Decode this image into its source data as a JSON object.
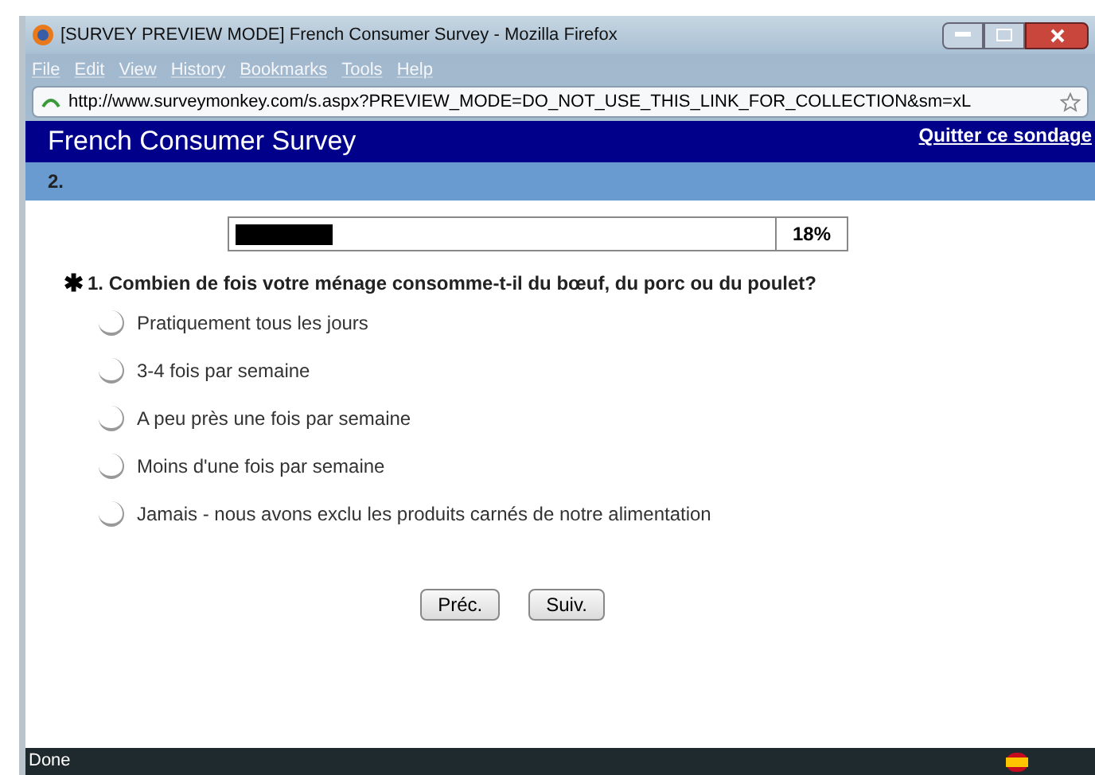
{
  "window": {
    "title": "[SURVEY PREVIEW MODE] French Consumer Survey - Mozilla Firefox"
  },
  "menu": [
    "File",
    "Edit",
    "View",
    "History",
    "Bookmarks",
    "Tools",
    "Help"
  ],
  "address_bar": {
    "value": "http://www.surveymonkey.com/s.aspx?PREVIEW_MODE=DO_NOT_USE_THIS_LINK_FOR_COLLECTION&sm=xL"
  },
  "survey": {
    "title": "French Consumer Survey",
    "exit_link": "Quitter ce sondage",
    "page_label": "2.",
    "progress": {
      "level": 0.18,
      "reading": "18%"
    },
    "question": {
      "required_mark": "✱",
      "text": "1. Combien de fois votre ménage consomme-t-il du bœuf, du porc ou du poulet?",
      "options": [
        {
          "label": "Pratiquement tous les jours",
          "selected": false
        },
        {
          "label": "3-4 fois par semaine",
          "selected": false
        },
        {
          "label": "A peu près une fois par semaine",
          "selected": false
        },
        {
          "label": "Moins d'une fois par semaine",
          "selected": false
        },
        {
          "label": "Jamais - nous avons exclu les produits carnés de notre alimentation",
          "selected": false
        }
      ]
    },
    "buttons": [
      "Préc.",
      "Suiv."
    ]
  },
  "status_bar": {
    "text": "Done"
  }
}
